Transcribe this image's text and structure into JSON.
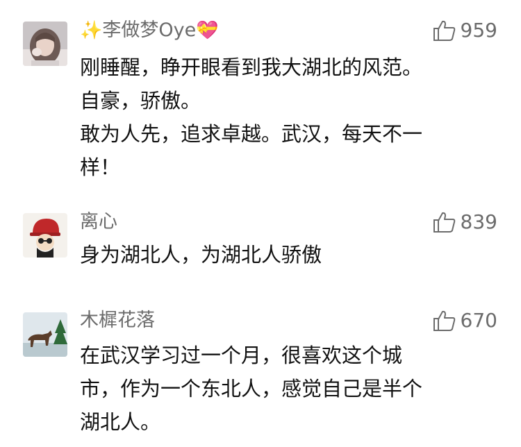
{
  "comments": [
    {
      "username_prefix": "✨",
      "username": "李做梦Oye",
      "username_suffix": "💝",
      "likes": "959",
      "lines": [
        "刚睡醒，睁开眼看到我大湖北的风范。",
        "自豪，骄傲。",
        "敢为人先，追求卓越。武汉，每天不一",
        "样！"
      ],
      "avatar": "girl-photo"
    },
    {
      "username": "离心",
      "likes": "839",
      "lines": [
        "身为湖北人，为湖北人骄傲"
      ],
      "avatar": "cartoon-red-hat"
    },
    {
      "username": "木樨花落",
      "likes": "670",
      "lines": [
        "在武汉学习过一个月，很喜欢这个城",
        "市，作为一个东北人，感觉自己是半个",
        "湖北人。"
      ],
      "avatar": "horse-landscape"
    }
  ],
  "colors": {
    "username": "#6b6b6b",
    "body_text": "#111111",
    "like": "#6b6b6b",
    "background": "#ffffff"
  },
  "icons": {
    "like": "thumbs-up-icon"
  }
}
